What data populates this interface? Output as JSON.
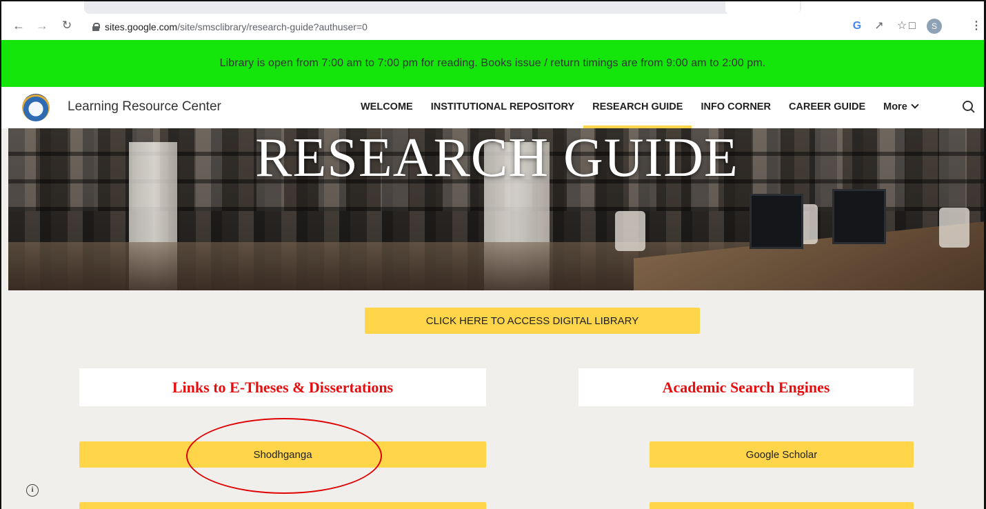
{
  "browser": {
    "url_host": "sites.google.com",
    "url_path": "/site/smsclibrary/research-guide?authuser=0",
    "avatar_letter": "S",
    "icons": [
      "back-arrow-icon",
      "forward-arrow-icon",
      "reload-icon",
      "lock-icon",
      "google-icon",
      "share-icon",
      "bookmark-star-icon",
      "side-panel-icon",
      "profile-avatar",
      "kebab-menu-icon"
    ]
  },
  "announcement": {
    "text": "Library is open from 7:00 am to 7:00 pm for reading. Books issue / return timings are from 9:00 am to 2:00 pm.",
    "background": "#14e60c"
  },
  "site": {
    "name": "Learning Resource Center",
    "nav": [
      {
        "label": "WELCOME",
        "active": false
      },
      {
        "label": "INSTITUTIONAL REPOSITORY",
        "active": false
      },
      {
        "label": "RESEARCH GUIDE",
        "active": true
      },
      {
        "label": "INFO CORNER",
        "active": false
      },
      {
        "label": "CAREER GUIDE",
        "active": false
      },
      {
        "label": "More",
        "active": false
      }
    ],
    "accent": "#ffd54a"
  },
  "hero": {
    "title": "RESEARCH GUIDE"
  },
  "content": {
    "digital_library_button": "CLICK HERE TO ACCESS DIGITAL LIBRARY",
    "left_heading": "Links to E-Theses & Dissertations",
    "right_heading": "Academic Search Engines",
    "left_links": [
      "Shodhganga"
    ],
    "right_links": [
      "Google Scholar"
    ],
    "heading_color": "#e50d0d"
  }
}
